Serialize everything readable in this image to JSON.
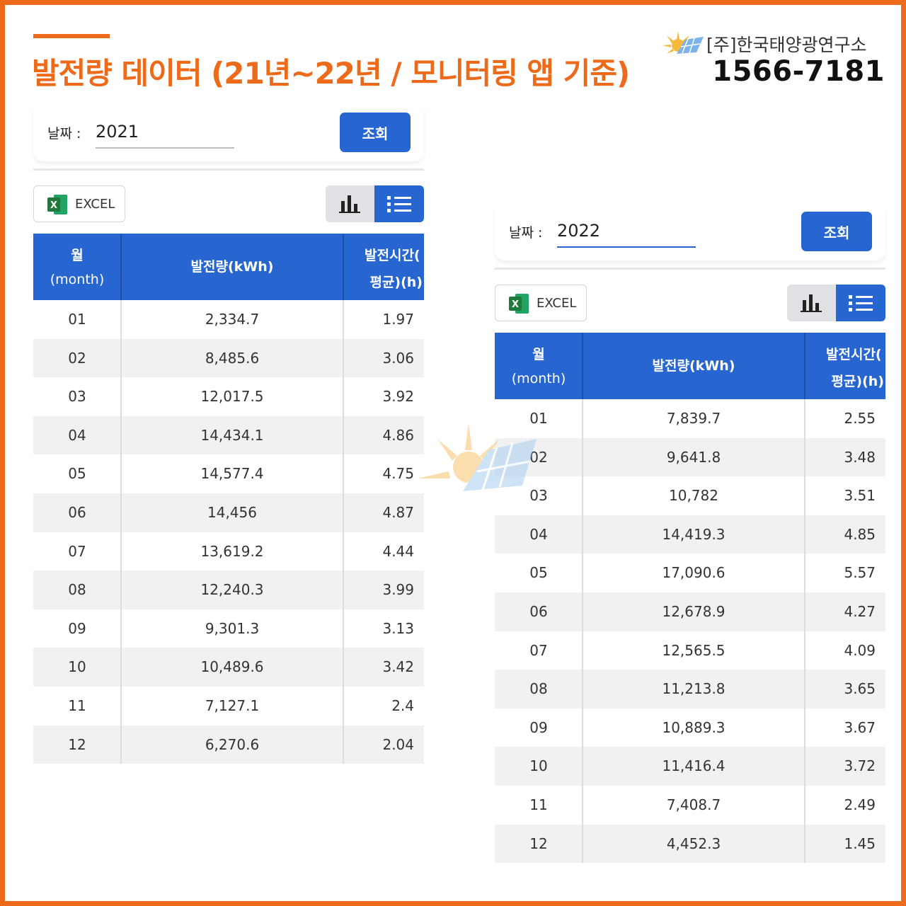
{
  "header": {
    "title": "발전량 데이터 (21년~22년 / 모니터링 앱 기준)",
    "brand_name": "[주]한국태양광연구소",
    "brand_phone": "1566-7181"
  },
  "colors": {
    "accent_orange": "#ec6a1a",
    "primary_blue": "#2766d0",
    "excel_green": "#1d7a3a"
  },
  "labels": {
    "date_label": "날짜 :",
    "search_button": "조회",
    "excel_button": "EXCEL",
    "col_month_1": "월",
    "col_month_2": "(month)",
    "col_energy": "발전량(kWh)",
    "col_hours_1": "발전시간(",
    "col_hours_2": "평균)(h)"
  },
  "panels": [
    {
      "year": "2021",
      "rows": [
        {
          "month": "01",
          "energy": "2,334.7",
          "hours": "1.97"
        },
        {
          "month": "02",
          "energy": "8,485.6",
          "hours": "3.06"
        },
        {
          "month": "03",
          "energy": "12,017.5",
          "hours": "3.92"
        },
        {
          "month": "04",
          "energy": "14,434.1",
          "hours": "4.86"
        },
        {
          "month": "05",
          "energy": "14,577.4",
          "hours": "4.75"
        },
        {
          "month": "06",
          "energy": "14,456",
          "hours": "4.87"
        },
        {
          "month": "07",
          "energy": "13,619.2",
          "hours": "4.44"
        },
        {
          "month": "08",
          "energy": "12,240.3",
          "hours": "3.99"
        },
        {
          "month": "09",
          "energy": "9,301.3",
          "hours": "3.13"
        },
        {
          "month": "10",
          "energy": "10,489.6",
          "hours": "3.42"
        },
        {
          "month": "11",
          "energy": "7,127.1",
          "hours": "2.4"
        },
        {
          "month": "12",
          "energy": "6,270.6",
          "hours": "2.04"
        }
      ]
    },
    {
      "year": "2022",
      "rows": [
        {
          "month": "01",
          "energy": "7,839.7",
          "hours": "2.55"
        },
        {
          "month": "02",
          "energy": "9,641.8",
          "hours": "3.48"
        },
        {
          "month": "03",
          "energy": "10,782",
          "hours": "3.51"
        },
        {
          "month": "04",
          "energy": "14,419.3",
          "hours": "4.85"
        },
        {
          "month": "05",
          "energy": "17,090.6",
          "hours": "5.57"
        },
        {
          "month": "06",
          "energy": "12,678.9",
          "hours": "4.27"
        },
        {
          "month": "07",
          "energy": "12,565.5",
          "hours": "4.09"
        },
        {
          "month": "08",
          "energy": "11,213.8",
          "hours": "3.65"
        },
        {
          "month": "09",
          "energy": "10,889.3",
          "hours": "3.67"
        },
        {
          "month": "10",
          "energy": "11,416.4",
          "hours": "3.72"
        },
        {
          "month": "11",
          "energy": "7,408.7",
          "hours": "2.49"
        },
        {
          "month": "12",
          "energy": "4,452.3",
          "hours": "1.45"
        }
      ]
    }
  ],
  "icons": {
    "brand_logo": "sun-solar-panel-icon",
    "excel": "excel-icon",
    "chart_view": "bar-chart-icon",
    "list_view": "list-icon"
  }
}
